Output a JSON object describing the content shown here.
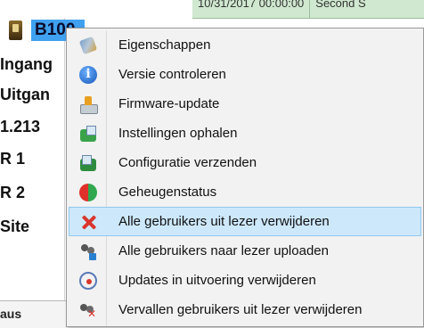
{
  "background": {
    "top_cells": [
      "10/31/2017 00:00:00",
      "Second S"
    ],
    "node_label": "B100",
    "left_labels": [
      "Ingang",
      "Uitgan",
      "1.213",
      "R 1",
      "R 2",
      "Site"
    ],
    "status_label": "aus"
  },
  "context_menu": {
    "items": [
      {
        "label": "Eigenschappen",
        "icon": "properties-tools-icon"
      },
      {
        "label": "Versie controleren",
        "icon": "info-icon"
      },
      {
        "label": "Firmware-update",
        "icon": "firmware-update-icon"
      },
      {
        "label": "Instellingen ophalen",
        "icon": "fetch-settings-icon"
      },
      {
        "label": "Configuratie verzenden",
        "icon": "send-configuration-icon"
      },
      {
        "label": "Geheugenstatus",
        "icon": "memory-status-icon"
      },
      {
        "label": "Alle gebruikers uit lezer verwijderen",
        "icon": "red-x-delete-icon",
        "highlighted": true
      },
      {
        "label": "Alle gebruikers naar lezer uploaden",
        "icon": "users-upload-icon"
      },
      {
        "label": "Updates in uitvoering verwijderen",
        "icon": "cancel-updates-icon"
      },
      {
        "label": "Vervallen gebruikers uit lezer verwijderen",
        "icon": "expired-users-delete-icon"
      }
    ]
  },
  "colors": {
    "menu_background": "#f2f2f2",
    "highlight": "#cde8fb",
    "selection": "#3fa1ef",
    "header_green": "#cfe8cf"
  }
}
